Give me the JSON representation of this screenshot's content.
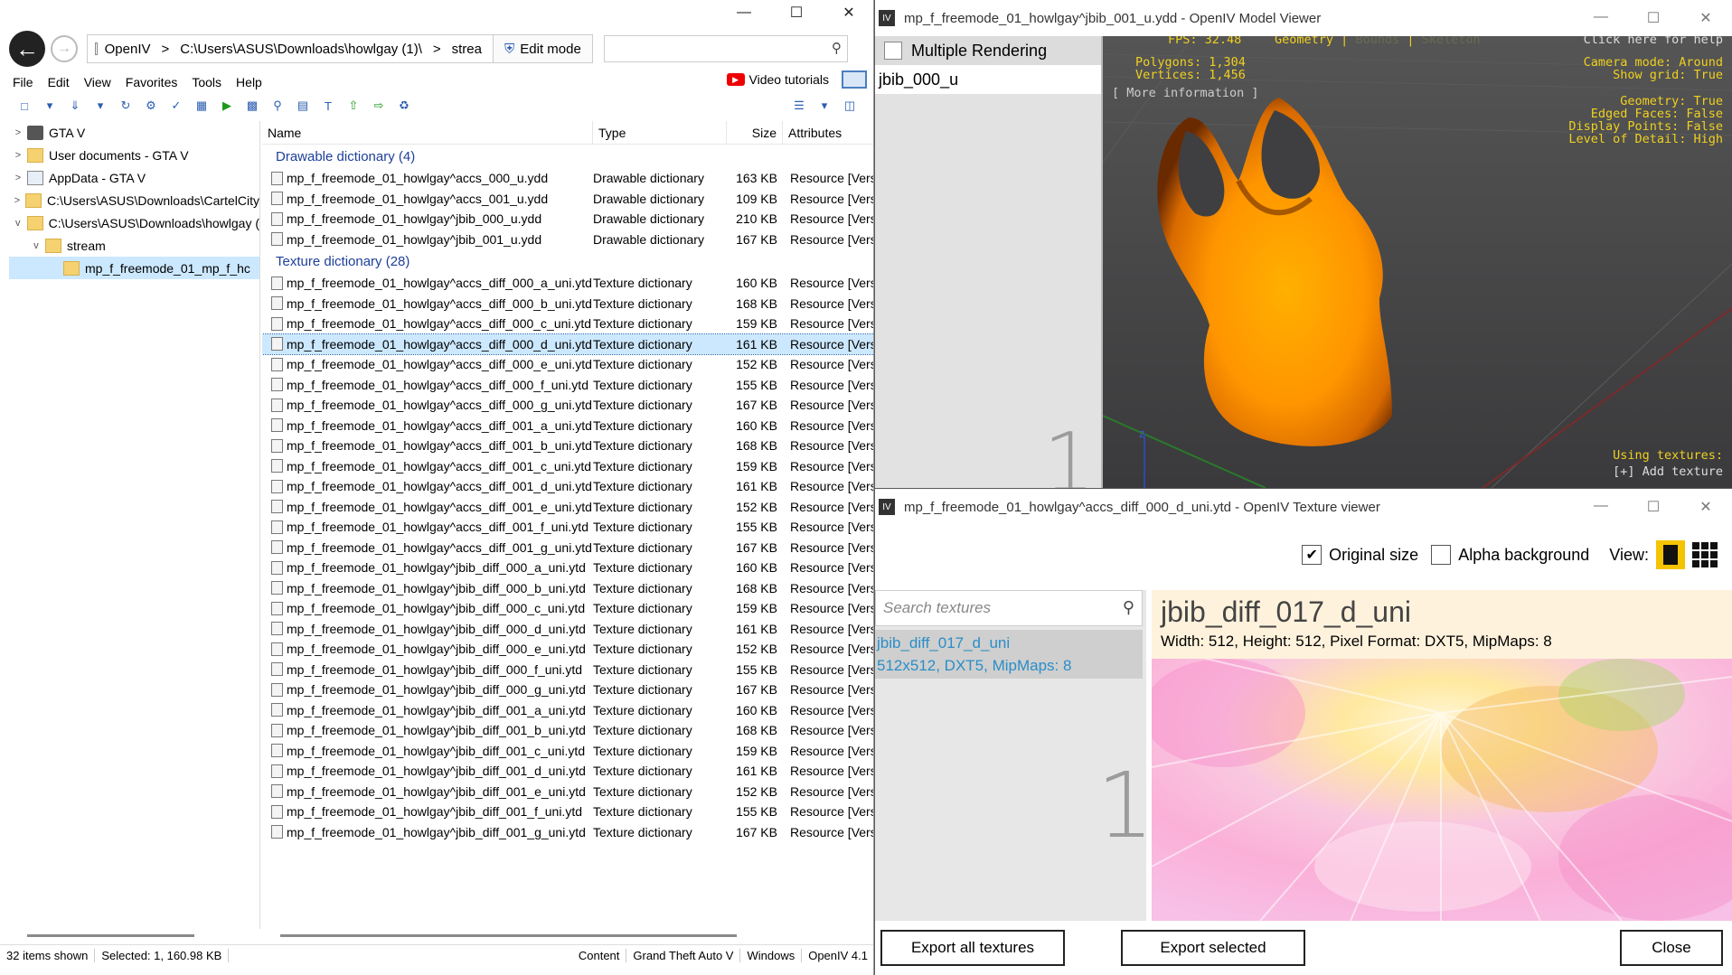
{
  "explorer": {
    "window_controls": [
      "—",
      "☐",
      "✕"
    ],
    "breadcrumbs": [
      "OpenIV",
      ">",
      "C:\\Users\\ASUS\\Downloads\\howlgay (1)\\",
      ">",
      "strea"
    ],
    "edit_mode": "Edit mode",
    "search_value": "",
    "menu": [
      "File",
      "Edit",
      "View",
      "Favorites",
      "Tools",
      "Help"
    ],
    "video_tutorials": "Video tutorials",
    "tree": [
      {
        "label": "GTA V",
        "exp": ">"
      },
      {
        "label": "User documents - GTA V",
        "exp": ">"
      },
      {
        "label": "AppData - GTA V",
        "exp": ">"
      },
      {
        "label": "C:\\Users\\ASUS\\Downloads\\CartelCity",
        "exp": ">"
      },
      {
        "label": "C:\\Users\\ASUS\\Downloads\\howlgay (",
        "exp": "v"
      },
      {
        "label": "stream",
        "exp": "v"
      },
      {
        "label": "mp_f_freemode_01_mp_f_hc",
        "exp": ""
      }
    ],
    "columns": {
      "name": "Name",
      "type": "Type",
      "size": "Size",
      "attributes": "Attributes"
    },
    "group_drawable": "Drawable dictionary (4)",
    "group_texture": "Texture dictionary (28)",
    "drawables": [
      [
        "mp_f_freemode_01_howlgay^accs_000_u.ydd",
        "Drawable dictionary",
        "163 KB",
        "Resource [Version"
      ],
      [
        "mp_f_freemode_01_howlgay^accs_001_u.ydd",
        "Drawable dictionary",
        "109 KB",
        "Resource [Version"
      ],
      [
        "mp_f_freemode_01_howlgay^jbib_000_u.ydd",
        "Drawable dictionary",
        "210 KB",
        "Resource [Version"
      ],
      [
        "mp_f_freemode_01_howlgay^jbib_001_u.ydd",
        "Drawable dictionary",
        "167 KB",
        "Resource [Version"
      ]
    ],
    "textures": [
      [
        "mp_f_freemode_01_howlgay^accs_diff_000_a_uni.ytd",
        "Texture dictionary",
        "160 KB",
        "Resource [Version"
      ],
      [
        "mp_f_freemode_01_howlgay^accs_diff_000_b_uni.ytd",
        "Texture dictionary",
        "168 KB",
        "Resource [Version"
      ],
      [
        "mp_f_freemode_01_howlgay^accs_diff_000_c_uni.ytd",
        "Texture dictionary",
        "159 KB",
        "Resource [Version"
      ],
      [
        "mp_f_freemode_01_howlgay^accs_diff_000_d_uni.ytd",
        "Texture dictionary",
        "161 KB",
        "Resource [Version"
      ],
      [
        "mp_f_freemode_01_howlgay^accs_diff_000_e_uni.ytd",
        "Texture dictionary",
        "152 KB",
        "Resource [Version"
      ],
      [
        "mp_f_freemode_01_howlgay^accs_diff_000_f_uni.ytd",
        "Texture dictionary",
        "155 KB",
        "Resource [Version"
      ],
      [
        "mp_f_freemode_01_howlgay^accs_diff_000_g_uni.ytd",
        "Texture dictionary",
        "167 KB",
        "Resource [Version"
      ],
      [
        "mp_f_freemode_01_howlgay^accs_diff_001_a_uni.ytd",
        "Texture dictionary",
        "160 KB",
        "Resource [Version"
      ],
      [
        "mp_f_freemode_01_howlgay^accs_diff_001_b_uni.ytd",
        "Texture dictionary",
        "168 KB",
        "Resource [Version"
      ],
      [
        "mp_f_freemode_01_howlgay^accs_diff_001_c_uni.ytd",
        "Texture dictionary",
        "159 KB",
        "Resource [Version"
      ],
      [
        "mp_f_freemode_01_howlgay^accs_diff_001_d_uni.ytd",
        "Texture dictionary",
        "161 KB",
        "Resource [Version"
      ],
      [
        "mp_f_freemode_01_howlgay^accs_diff_001_e_uni.ytd",
        "Texture dictionary",
        "152 KB",
        "Resource [Version"
      ],
      [
        "mp_f_freemode_01_howlgay^accs_diff_001_f_uni.ytd",
        "Texture dictionary",
        "155 KB",
        "Resource [Version"
      ],
      [
        "mp_f_freemode_01_howlgay^accs_diff_001_g_uni.ytd",
        "Texture dictionary",
        "167 KB",
        "Resource [Version"
      ],
      [
        "mp_f_freemode_01_howlgay^jbib_diff_000_a_uni.ytd",
        "Texture dictionary",
        "160 KB",
        "Resource [Version"
      ],
      [
        "mp_f_freemode_01_howlgay^jbib_diff_000_b_uni.ytd",
        "Texture dictionary",
        "168 KB",
        "Resource [Version"
      ],
      [
        "mp_f_freemode_01_howlgay^jbib_diff_000_c_uni.ytd",
        "Texture dictionary",
        "159 KB",
        "Resource [Version"
      ],
      [
        "mp_f_freemode_01_howlgay^jbib_diff_000_d_uni.ytd",
        "Texture dictionary",
        "161 KB",
        "Resource [Version"
      ],
      [
        "mp_f_freemode_01_howlgay^jbib_diff_000_e_uni.ytd",
        "Texture dictionary",
        "152 KB",
        "Resource [Version"
      ],
      [
        "mp_f_freemode_01_howlgay^jbib_diff_000_f_uni.ytd",
        "Texture dictionary",
        "155 KB",
        "Resource [Version"
      ],
      [
        "mp_f_freemode_01_howlgay^jbib_diff_000_g_uni.ytd",
        "Texture dictionary",
        "167 KB",
        "Resource [Version"
      ],
      [
        "mp_f_freemode_01_howlgay^jbib_diff_001_a_uni.ytd",
        "Texture dictionary",
        "160 KB",
        "Resource [Version"
      ],
      [
        "mp_f_freemode_01_howlgay^jbib_diff_001_b_uni.ytd",
        "Texture dictionary",
        "168 KB",
        "Resource [Version"
      ],
      [
        "mp_f_freemode_01_howlgay^jbib_diff_001_c_uni.ytd",
        "Texture dictionary",
        "159 KB",
        "Resource [Version"
      ],
      [
        "mp_f_freemode_01_howlgay^jbib_diff_001_d_uni.ytd",
        "Texture dictionary",
        "161 KB",
        "Resource [Version"
      ],
      [
        "mp_f_freemode_01_howlgay^jbib_diff_001_e_uni.ytd",
        "Texture dictionary",
        "152 KB",
        "Resource [Version"
      ],
      [
        "mp_f_freemode_01_howlgay^jbib_diff_001_f_uni.ytd",
        "Texture dictionary",
        "155 KB",
        "Resource [Version"
      ],
      [
        "mp_f_freemode_01_howlgay^jbib_diff_001_g_uni.ytd",
        "Texture dictionary",
        "167 KB",
        "Resource [Version"
      ]
    ],
    "selected_texture_index": 3,
    "status": [
      "32 items shown",
      "Selected: 1,  160.98 KB",
      "Content",
      "Grand Theft Auto V",
      "Windows",
      "OpenIV 4.1"
    ]
  },
  "model_viewer": {
    "title": "mp_f_freemode_01_howlgay^jbib_001_u.ydd - OpenIV Model Viewer",
    "app_icon": "IV",
    "multiple_rendering": "Multiple Rendering",
    "item": "jbib_000_u",
    "count": "1",
    "fps": "FPS: 32.48",
    "tabs": [
      "Geometry",
      "Bounds",
      "Skeleton"
    ],
    "sep": "|",
    "help": "Click here for help",
    "polygons": "Polygons: 1,304",
    "vertices": "Vertices: 1,456",
    "more_info": "[ More information ]",
    "camera_mode": "Camera mode: Around",
    "show_grid": "Show grid: True",
    "geometry": "Geometry: True",
    "edged_faces": "Edged Faces: False",
    "display_points": "Display Points: False",
    "lod": "Level of Detail: High",
    "using_textures": "Using textures:",
    "add_texture": "[+] Add texture",
    "axis_z": "z",
    "colors": {
      "shirt": "#ff9a00",
      "hud": "#f0d020"
    }
  },
  "texture_viewer": {
    "title": "mp_f_freemode_01_howlgay^accs_diff_000_d_uni.ytd - OpenIV Texture viewer",
    "app_icon": "IV",
    "original_size": "Original size",
    "alpha_background": "Alpha background",
    "view": "View:",
    "search_placeholder": "Search textures",
    "item_name": "jbib_diff_017_d_uni",
    "item_info": "512x512, DXT5, MipMaps: 8",
    "count": "1",
    "tex_name": "jbib_diff_017_d_uni",
    "tex_dims": "Width: 512, Height: 512, Pixel Format: DXT5, MipMaps: 8",
    "export_all": "Export all textures",
    "export_selected": "Export selected",
    "close": "Close"
  }
}
